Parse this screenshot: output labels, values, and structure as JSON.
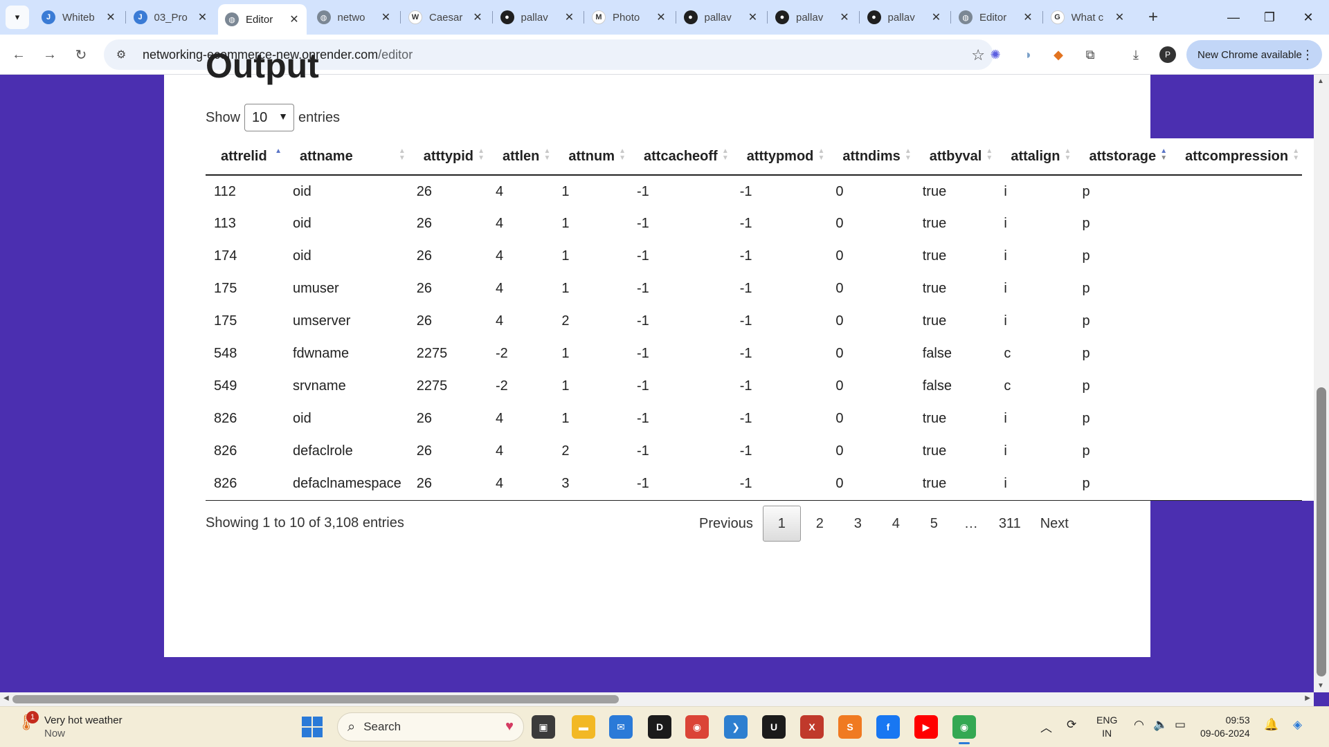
{
  "browser": {
    "tabs": [
      {
        "title": "Whiteb",
        "favicon": "jsfiddle-icon",
        "color": "#3a7bd5",
        "glyph": "J"
      },
      {
        "title": "03_Pro",
        "favicon": "jsfiddle-icon",
        "color": "#3a7bd5",
        "glyph": "J"
      },
      {
        "title": "Editor",
        "favicon": "globe-icon",
        "color": "#7b8794",
        "glyph": "◍",
        "active": true
      },
      {
        "title": "netwo",
        "favicon": "globe-icon",
        "color": "#7b8794",
        "glyph": "◍"
      },
      {
        "title": "Caesar",
        "favicon": "wikipedia-icon",
        "color": "#ffffff",
        "glyph": "W"
      },
      {
        "title": "pallav",
        "favicon": "github-icon",
        "color": "#1f1f1f",
        "glyph": "●"
      },
      {
        "title": "Photo",
        "favicon": "gmail-icon",
        "color": "#ffffff",
        "glyph": "M"
      },
      {
        "title": "pallav",
        "favicon": "github-icon",
        "color": "#1f1f1f",
        "glyph": "●"
      },
      {
        "title": "pallav",
        "favicon": "github-icon",
        "color": "#1f1f1f",
        "glyph": "●"
      },
      {
        "title": "pallav",
        "favicon": "github-icon",
        "color": "#1f1f1f",
        "glyph": "●"
      },
      {
        "title": "Editor",
        "favicon": "globe-icon",
        "color": "#7b8794",
        "glyph": "◍"
      },
      {
        "title": "What c",
        "favicon": "google-icon",
        "color": "#ffffff",
        "glyph": "G"
      }
    ],
    "url_host": "networking-ecommerce-new.onrender.com",
    "url_path": "/editor",
    "new_chrome_label": "New Chrome available",
    "profile_initial": "P"
  },
  "page": {
    "heading": "Output",
    "show_label": "Show",
    "entries_label": "entries",
    "page_length": "10",
    "columns": [
      "attrelid",
      "attname",
      "atttypid",
      "attlen",
      "attnum",
      "attcacheoff",
      "atttypmod",
      "attndims",
      "attbyval",
      "attalign",
      "attstorage",
      "attcompression"
    ],
    "rows": [
      [
        "112",
        "oid",
        "26",
        "4",
        "1",
        "-1",
        "-1",
        "0",
        "true",
        "i",
        "p",
        ""
      ],
      [
        "113",
        "oid",
        "26",
        "4",
        "1",
        "-1",
        "-1",
        "0",
        "true",
        "i",
        "p",
        ""
      ],
      [
        "174",
        "oid",
        "26",
        "4",
        "1",
        "-1",
        "-1",
        "0",
        "true",
        "i",
        "p",
        ""
      ],
      [
        "175",
        "umuser",
        "26",
        "4",
        "1",
        "-1",
        "-1",
        "0",
        "true",
        "i",
        "p",
        ""
      ],
      [
        "175",
        "umserver",
        "26",
        "4",
        "2",
        "-1",
        "-1",
        "0",
        "true",
        "i",
        "p",
        ""
      ],
      [
        "548",
        "fdwname",
        "2275",
        "-2",
        "1",
        "-1",
        "-1",
        "0",
        "false",
        "c",
        "p",
        ""
      ],
      [
        "549",
        "srvname",
        "2275",
        "-2",
        "1",
        "-1",
        "-1",
        "0",
        "false",
        "c",
        "p",
        ""
      ],
      [
        "826",
        "oid",
        "26",
        "4",
        "1",
        "-1",
        "-1",
        "0",
        "true",
        "i",
        "p",
        ""
      ],
      [
        "826",
        "defaclrole",
        "26",
        "4",
        "2",
        "-1",
        "-1",
        "0",
        "true",
        "i",
        "p",
        ""
      ],
      [
        "826",
        "defaclnamespace",
        "26",
        "4",
        "3",
        "-1",
        "-1",
        "0",
        "true",
        "i",
        "p",
        ""
      ]
    ],
    "info": "Showing 1 to 10 of 3,108 entries",
    "pagination": {
      "previous": "Previous",
      "pages": [
        "1",
        "2",
        "3",
        "4",
        "5",
        "…",
        "311"
      ],
      "current": "1",
      "next": "Next"
    }
  },
  "taskbar": {
    "weather_title": "Very hot weather",
    "weather_sub": "Now",
    "weather_badge": "1",
    "search_placeholder": "Search",
    "lang_top": "ENG",
    "lang_bottom": "IN",
    "time": "09:53",
    "date": "09-06-2024",
    "apps": [
      {
        "name": "task-view-icon",
        "glyph": "▣",
        "color": "#3b3b3b"
      },
      {
        "name": "file-explorer-icon",
        "glyph": "▬",
        "color": "#f2b825"
      },
      {
        "name": "mail-icon",
        "glyph": "✉",
        "color": "#2a7ad8"
      },
      {
        "name": "dell-icon",
        "glyph": "D",
        "color": "#1b1b1b"
      },
      {
        "name": "chrome-icon",
        "glyph": "◉",
        "color": "#db4437"
      },
      {
        "name": "vscode-icon",
        "glyph": "❯",
        "color": "#2d7fd0"
      },
      {
        "name": "unreal-icon",
        "glyph": "U",
        "color": "#1b1b1b"
      },
      {
        "name": "xampp-icon",
        "glyph": "X",
        "color": "#c0392b"
      },
      {
        "name": "sublime-icon",
        "glyph": "S",
        "color": "#f07a21"
      },
      {
        "name": "facebook-icon",
        "glyph": "f",
        "color": "#1877f2"
      },
      {
        "name": "youtube-icon",
        "glyph": "▶",
        "color": "#ff0000"
      },
      {
        "name": "chrome-active-icon",
        "glyph": "◉",
        "color": "#34a853"
      }
    ]
  }
}
